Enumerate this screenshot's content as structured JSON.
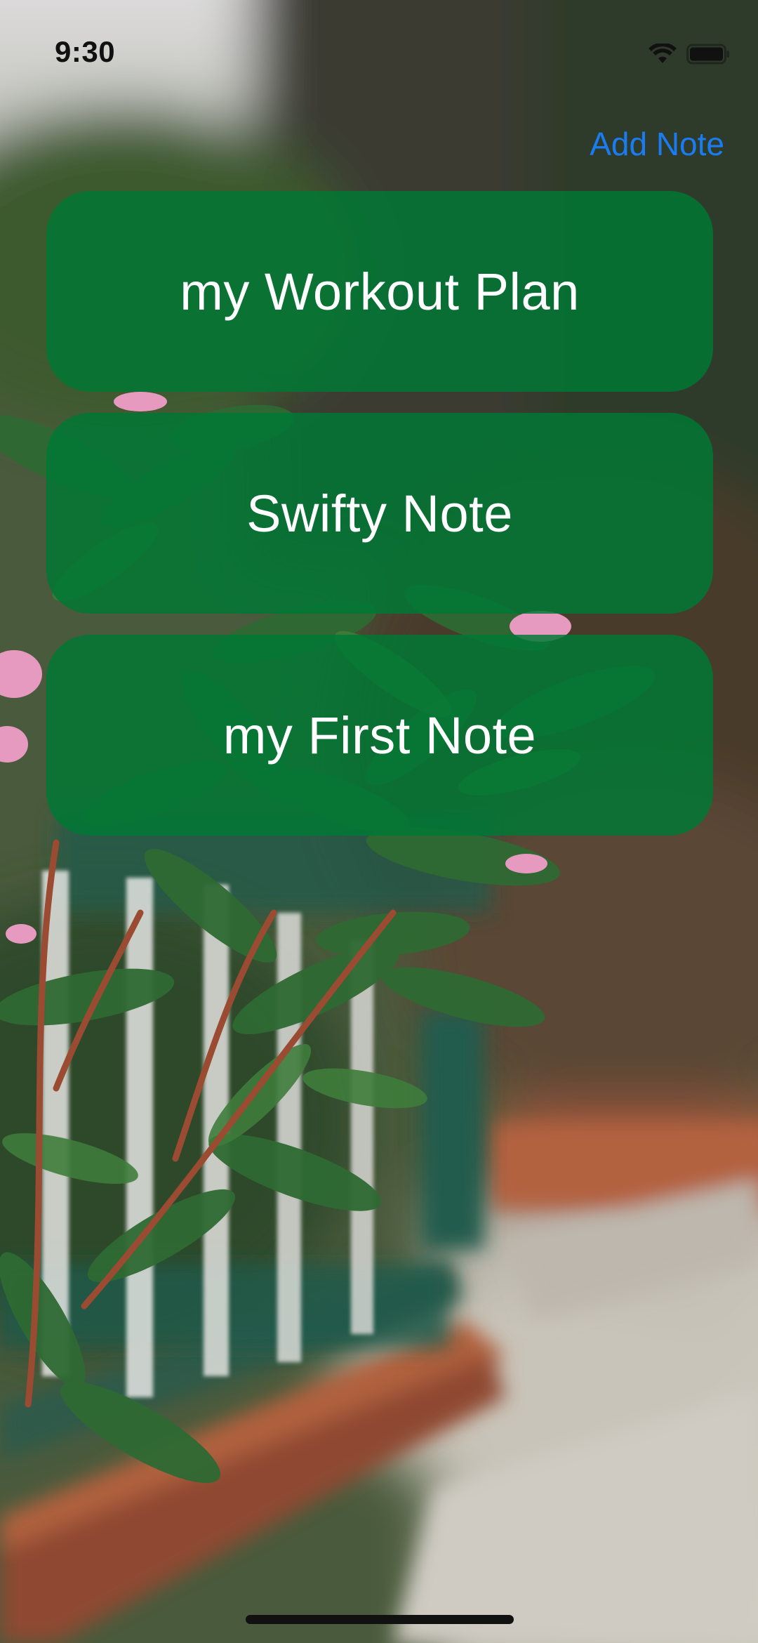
{
  "status_bar": {
    "time": "9:30",
    "icons": [
      "wifi-icon",
      "battery-icon"
    ]
  },
  "nav": {
    "add_note_label": "Add Note",
    "accent_color": "#1a7cf0"
  },
  "notes": [
    {
      "title": "my Workout Plan"
    },
    {
      "title": "Swifty Note"
    },
    {
      "title": "my First Note"
    }
  ],
  "colors": {
    "note_card": "#007834",
    "note_text": "#ffffff"
  }
}
